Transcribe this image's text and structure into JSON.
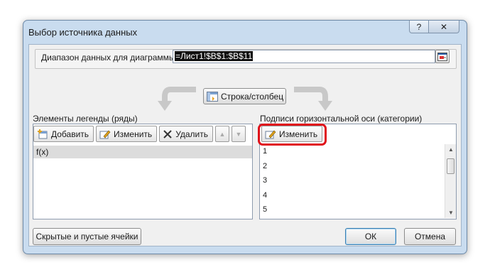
{
  "window": {
    "title": "Выбор источника данных",
    "help_label": "?",
    "close_label": "✕"
  },
  "range": {
    "label": "Диапазон данных для диаграммы:",
    "value": "=Лист1!$B$1:$B$11"
  },
  "switch_button": {
    "label": "Строка/столбец"
  },
  "legend": {
    "label": "Элементы легенды (ряды)",
    "add_label": "Добавить",
    "edit_label": "Изменить",
    "delete_label": "Удалить",
    "items": [
      "f(x)"
    ]
  },
  "axis": {
    "label": "Подписи горизонтальной оси (категории)",
    "edit_label": "Изменить",
    "items": [
      "1",
      "2",
      "3",
      "4",
      "5"
    ]
  },
  "footer": {
    "hidden_cells_label": "Скрытые и пустые ячейки",
    "ok_label": "ОК",
    "cancel_label": "Отмена"
  },
  "colors": {
    "highlight": "#e0121b",
    "window_frame": "#c9dcef"
  }
}
